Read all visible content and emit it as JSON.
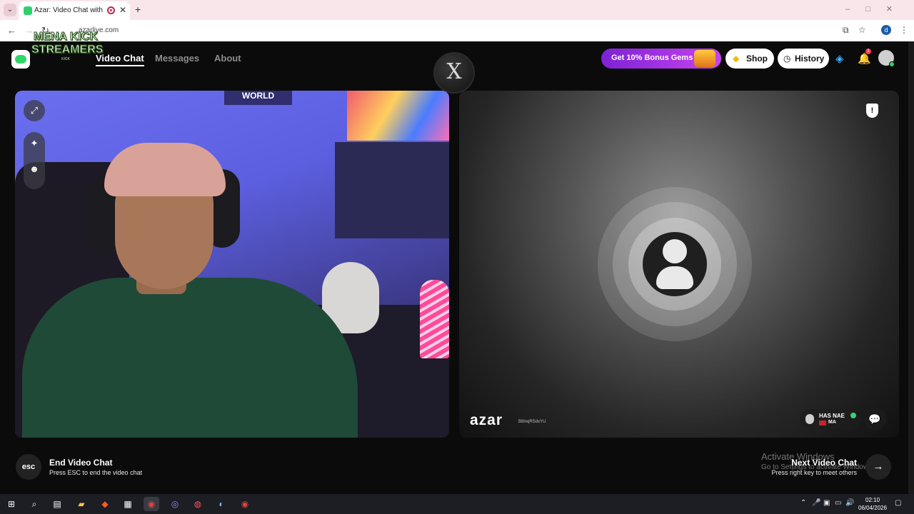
{
  "browser": {
    "tab_title": "Azar: Video Chat with New",
    "tab_close": "✕",
    "new_tab": "+",
    "url": "azarlive.com",
    "profile_initial": "d",
    "window_controls": "–□✕"
  },
  "nav": {
    "links": [
      "Video Chat",
      "Messages",
      "About"
    ]
  },
  "watermark": {
    "line1": "MENA KICK",
    "line2": "STREAMERS",
    "small": "KICK"
  },
  "center_logo": "X",
  "header": {
    "promo_text": "Get 10% Bonus Gems",
    "shop_label": "Shop",
    "history_label": "History",
    "notification_count": "1"
  },
  "self_camera": {
    "sign_text": "WORLD",
    "tools": [
      "expand-icon",
      "magic-wand-icon",
      "face-sticker-icon"
    ]
  },
  "peer": {
    "brand": "azar",
    "session_id": "B8inqRSdxYU",
    "name": "HAS NAE",
    "country": "MA",
    "report_symbol": "!"
  },
  "footer": {
    "esc_label": "esc",
    "end_title": "End Video Chat",
    "end_hint": "Press ESC to end the video chat",
    "next_title": "Next Video Chat",
    "next_hint": "Press right key to meet others",
    "activate_title": "Activate Windows",
    "activate_sub": "Go to Settings to activate Windows"
  },
  "taskbar": {
    "time": "02:10",
    "date": "06/04/2026"
  },
  "colors": {
    "promo_start": "#7d22d6",
    "promo_end": "#c744ee",
    "brand_green": "#30d66a",
    "app_background": "#0b0b0b",
    "browser_frame": "#f8e6ea"
  }
}
